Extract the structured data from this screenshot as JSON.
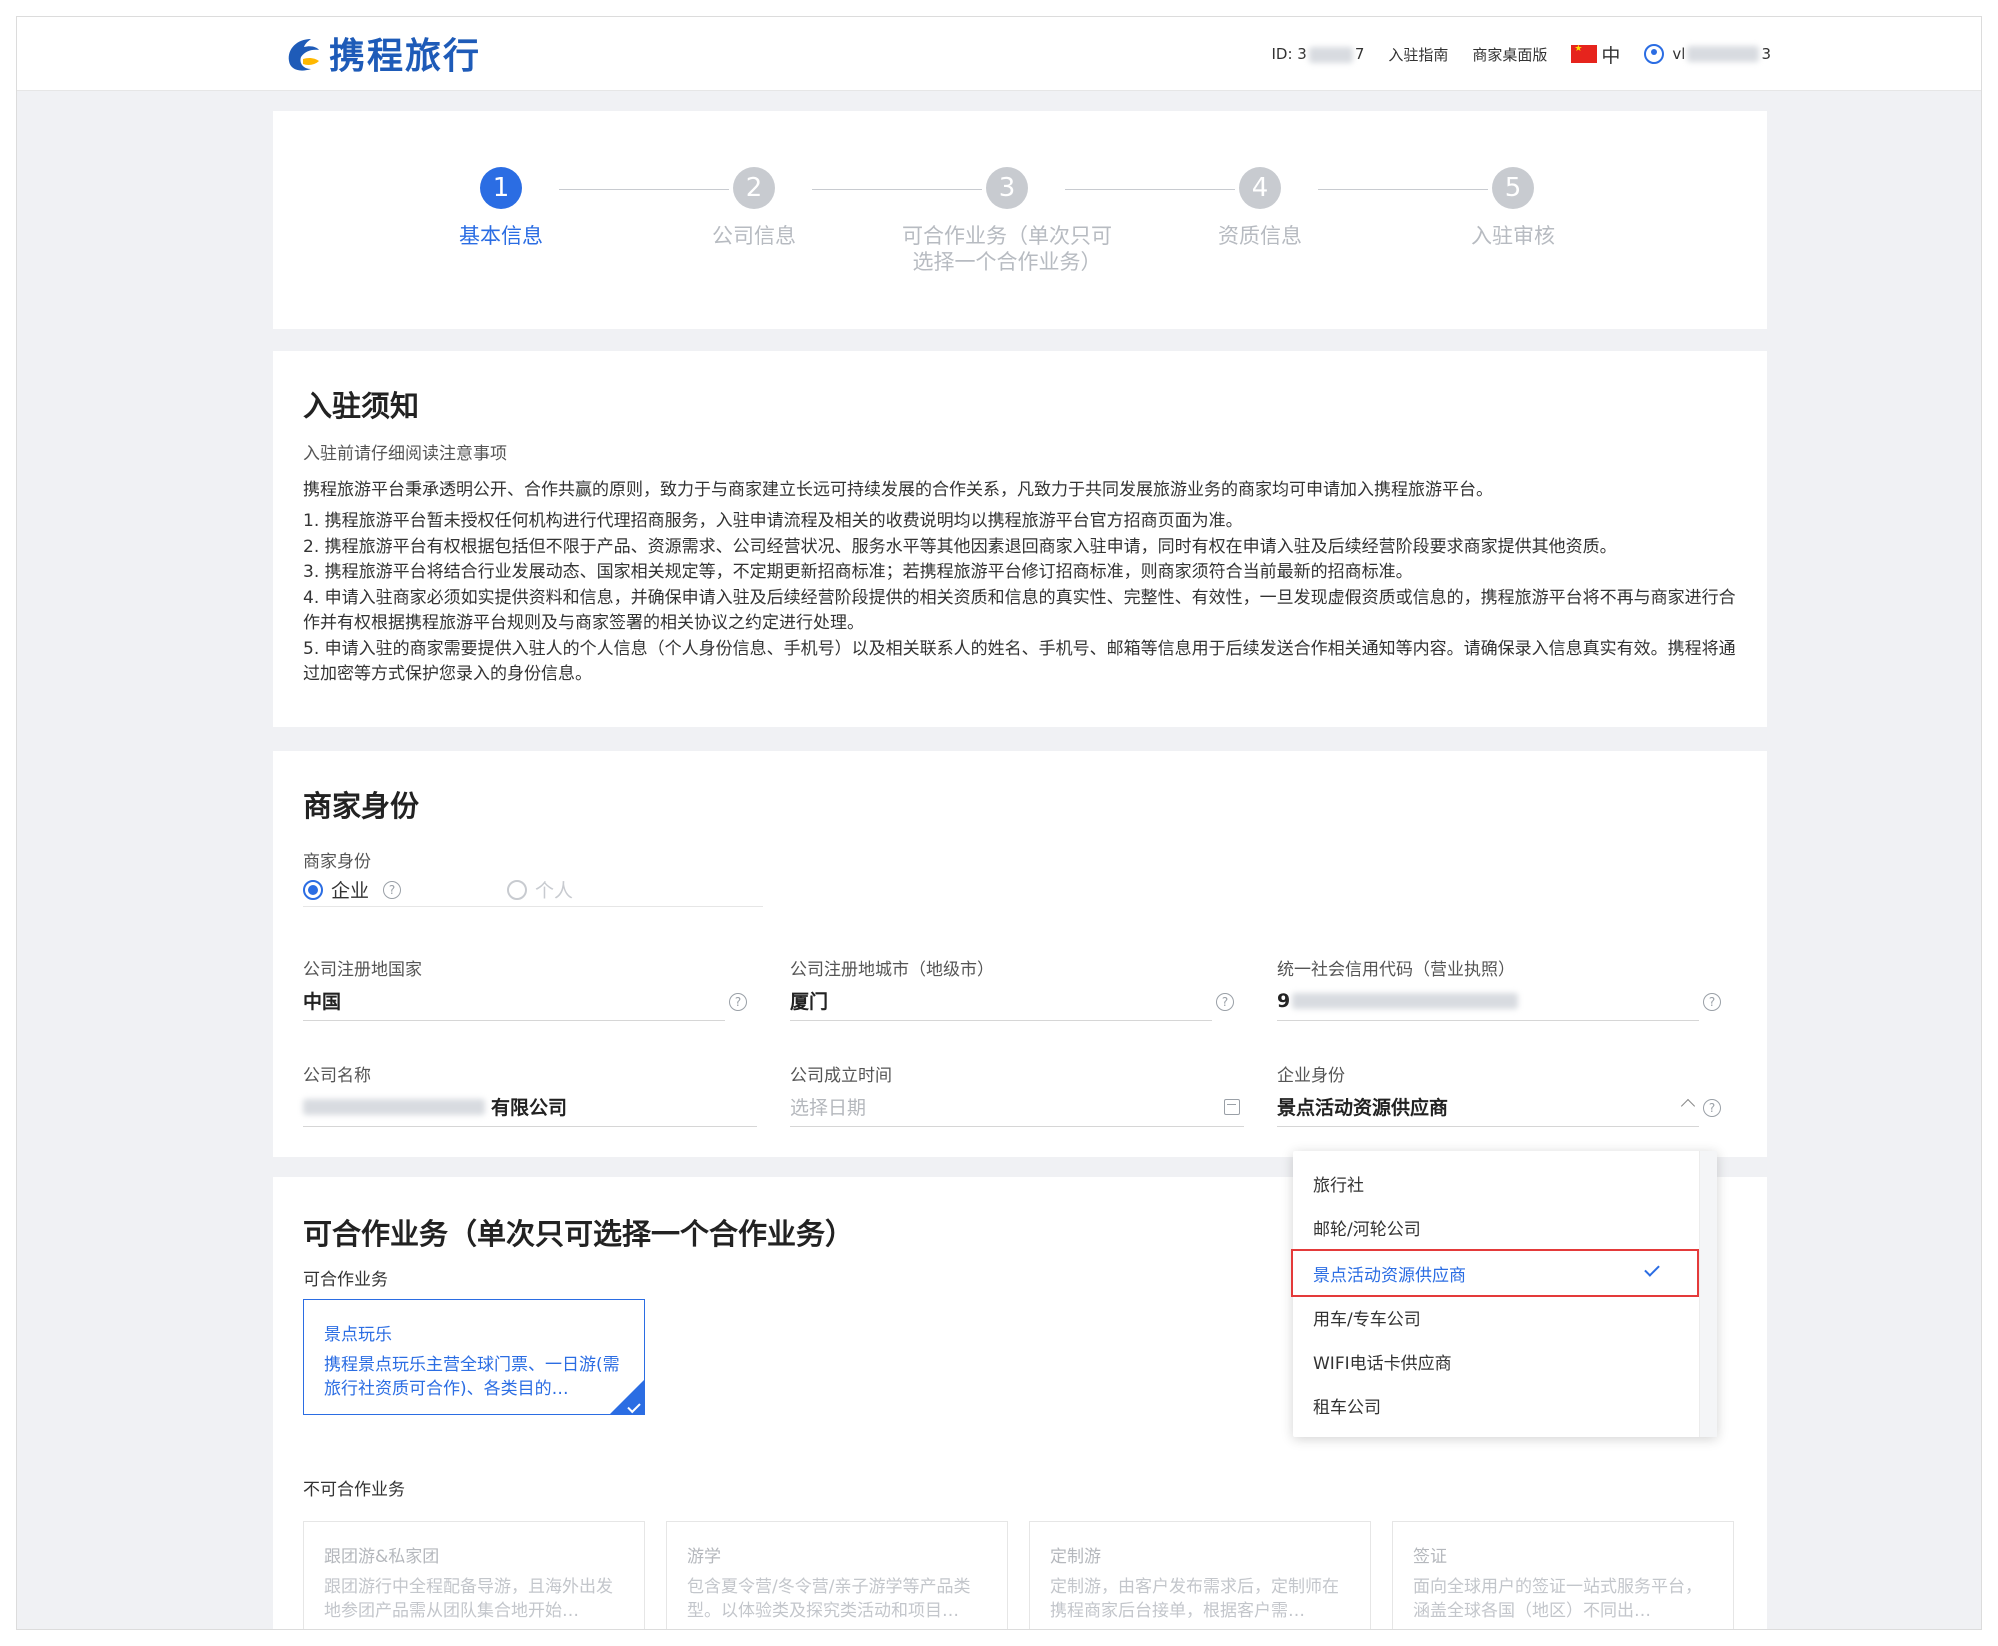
{
  "header": {
    "brand": "携程旅行",
    "user_id_prefix": "ID: 3",
    "user_id_suffix": "7",
    "links": [
      "入驻指南",
      "商家桌面版"
    ],
    "lang": "中",
    "username_prefix": "vl",
    "username_suffix": "3"
  },
  "steps": [
    {
      "num": "1",
      "label": "基本信息",
      "active": true
    },
    {
      "num": "2",
      "label": "公司信息",
      "active": false
    },
    {
      "num": "3",
      "label": "可合作业务（单次只可选择一个合作业务）",
      "active": false
    },
    {
      "num": "4",
      "label": "资质信息",
      "active": false
    },
    {
      "num": "5",
      "label": "入驻审核",
      "active": false
    }
  ],
  "notice": {
    "title": "入驻须知",
    "subtitle": "入驻前请仔细阅读注意事项",
    "intro": "携程旅游平台秉承透明公开、合作共赢的原则，致力于与商家建立长远可持续发展的合作关系，凡致力于共同发展旅游业务的商家均可申请加入携程旅游平台。",
    "items": [
      "1. 携程旅游平台暂未授权任何机构进行代理招商服务，入驻申请流程及相关的收费说明均以携程旅游平台官方招商页面为准。",
      "2. 携程旅游平台有权根据包括但不限于产品、资源需求、公司经营状况、服务水平等其他因素退回商家入驻申请，同时有权在申请入驻及后续经营阶段要求商家提供其他资质。",
      "3. 携程旅游平台将结合行业发展动态、国家相关规定等，不定期更新招商标准；若携程旅游平台修订招商标准，则商家须符合当前最新的招商标准。",
      "4. 申请入驻商家必须如实提供资料和信息，并确保申请入驻及后续经营阶段提供的相关资质和信息的真实性、完整性、有效性，一旦发现虚假资质或信息的，携程旅游平台将不再与商家进行合作并有权根据携程旅游平台规则及与商家签署的相关协议之约定进行处理。",
      "5. 申请入驻的商家需要提供入驻人的个人信息（个人身份信息、手机号）以及相关联系人的姓名、手机号、邮箱等信息用于后续发送合作相关通知等内容。请确保录入信息真实有效。携程将通过加密等方式保护您录入的身份信息。"
    ]
  },
  "identity": {
    "title": "商家身份",
    "type_label": "商家身份",
    "type_options": [
      {
        "label": "企业",
        "checked": true
      },
      {
        "label": "个人",
        "checked": false
      }
    ],
    "country_label": "公司注册地国家",
    "country_value": "中国",
    "city_label": "公司注册地城市（地级市）",
    "city_value": "厦门",
    "credit_label": "统一社会信用代码（营业执照）",
    "credit_value_prefix": "9",
    "name_label": "公司名称",
    "name_value_suffix": "有限公司",
    "founded_label": "公司成立时间",
    "founded_placeholder": "选择日期",
    "role_label": "企业身份",
    "role_value": "景点活动资源供应商"
  },
  "dropdown": {
    "options": [
      {
        "label": "旅行社",
        "selected": false
      },
      {
        "label": "邮轮/河轮公司",
        "selected": false
      },
      {
        "label": "景点活动资源供应商",
        "selected": true
      },
      {
        "label": "用车/专车公司",
        "selected": false
      },
      {
        "label": "WIFI电话卡供应商",
        "selected": false
      },
      {
        "label": "租车公司",
        "selected": false
      }
    ]
  },
  "business": {
    "title": "可合作业务（单次只可选择一个合作业务）",
    "available_label": "可合作业务",
    "available": [
      {
        "title": "景点玩乐",
        "desc": "携程景点玩乐主营全球门票、一日游(需旅行社资质可合作)、各类目的…"
      }
    ],
    "unavailable_label": "不可合作业务",
    "unavailable": [
      {
        "title": "跟团游&私家团",
        "desc": "跟团游行中全程配备导游，且海外出发地参团产品需从团队集合地开始…"
      },
      {
        "title": "游学",
        "desc": "包含夏令营/冬令营/亲子游学等产品类型。以体验类及探究类活动和项目…"
      },
      {
        "title": "定制游",
        "desc": "定制游，由客户发布需求后，定制师在携程商家后台接单，根据客户需…"
      },
      {
        "title": "签证",
        "desc": "面向全球用户的签证一站式服务平台，涵盖全球各国（地区）不同出…"
      }
    ]
  }
}
